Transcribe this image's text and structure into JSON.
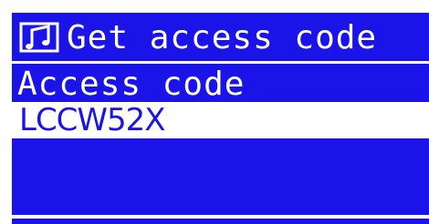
{
  "header": {
    "title": "Get access code",
    "icon": "music-notes-icon"
  },
  "access": {
    "label": "Access code",
    "code": "LCCW52X"
  },
  "colors": {
    "screen_background": "#1a14e8",
    "foreground": "#ffffff"
  }
}
